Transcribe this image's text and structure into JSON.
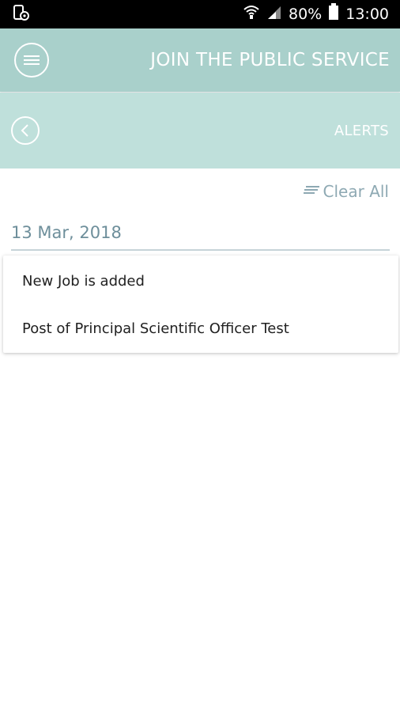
{
  "status_bar": {
    "notification_icon": "phone-lock-icon",
    "wifi_icon": "wifi-icon",
    "signal_icon": "signal-icon",
    "battery_percent": "80%",
    "battery_icon": "battery-icon",
    "time": "13:00"
  },
  "app_bar": {
    "menu_icon": "hamburger-menu-icon",
    "title": "JOIN THE PUBLIC SERVICE",
    "background": "#a9d0cb"
  },
  "sub_bar": {
    "back_icon": "chevron-left-icon",
    "title": "ALERTS",
    "background": "#bfe0db"
  },
  "actions": {
    "clear_all_icon": "lines-icon",
    "clear_all_label": "Clear All"
  },
  "alerts": [
    {
      "date": "13 Mar, 2018",
      "heading": "New Job is added",
      "detail": "Post of Principal Scientific Officer Test"
    }
  ]
}
